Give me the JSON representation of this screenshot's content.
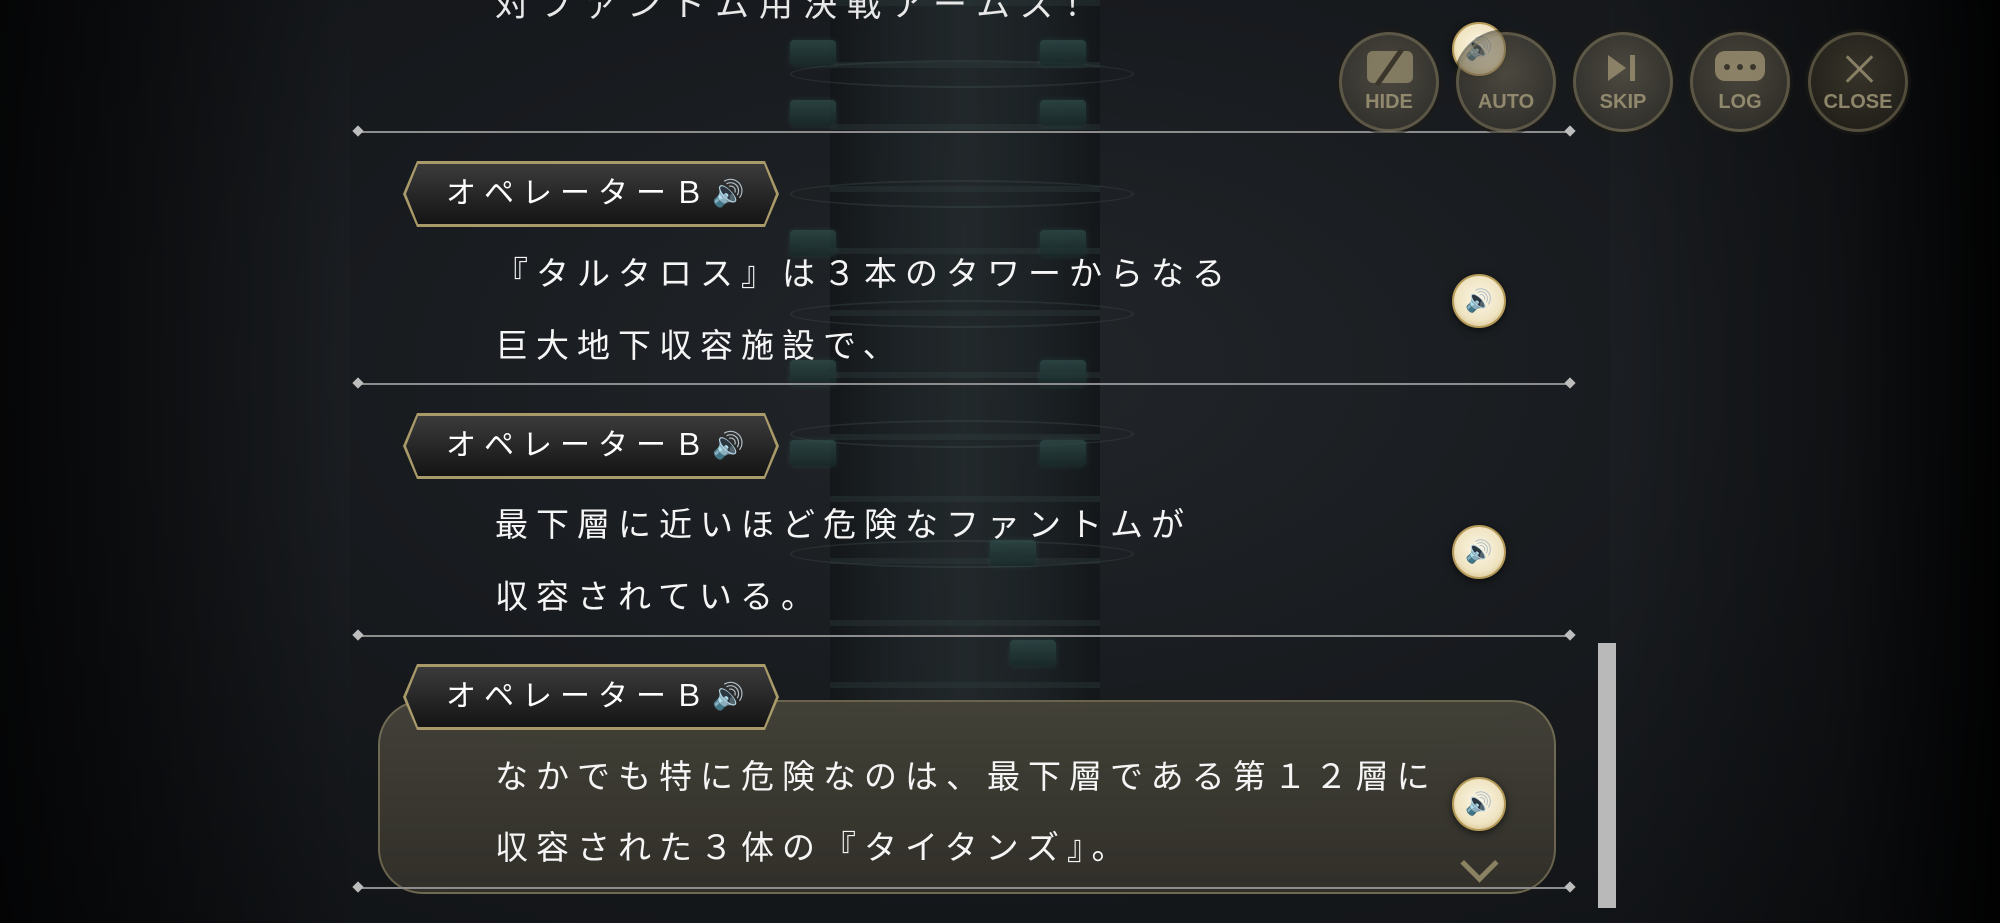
{
  "log": {
    "top_partial_line": "対ファントム用決戦アームズ！",
    "entries": [
      {
        "speaker": "オペレーターＢ",
        "lines": [
          "『タルタロス』は３本のタワーからなる",
          "巨大地下収容施設で、"
        ]
      },
      {
        "speaker": "オペレーターＢ",
        "lines": [
          "最下層に近いほど危険なファントムが",
          "収容されている。"
        ]
      },
      {
        "speaker": "オペレーターＢ",
        "lines": [
          "なかでも特に危険なのは、最下層である第１２層に",
          "収容された３体の『タイタンズ』。"
        ]
      }
    ]
  },
  "controls": {
    "hide": "HIDE",
    "auto": "AUTO",
    "skip": "SKIP",
    "log": "LOG",
    "close": "CLOSE"
  },
  "icons": {
    "voice": "speaker-icon",
    "hide": "eye-slash-icon",
    "skip": "skip-icon",
    "log": "chat-bubble-icon",
    "close": "close-icon"
  },
  "colors": {
    "accent_gold": "#a99a6a",
    "current_box": "#46443a",
    "divider": "#8d8d8d"
  }
}
